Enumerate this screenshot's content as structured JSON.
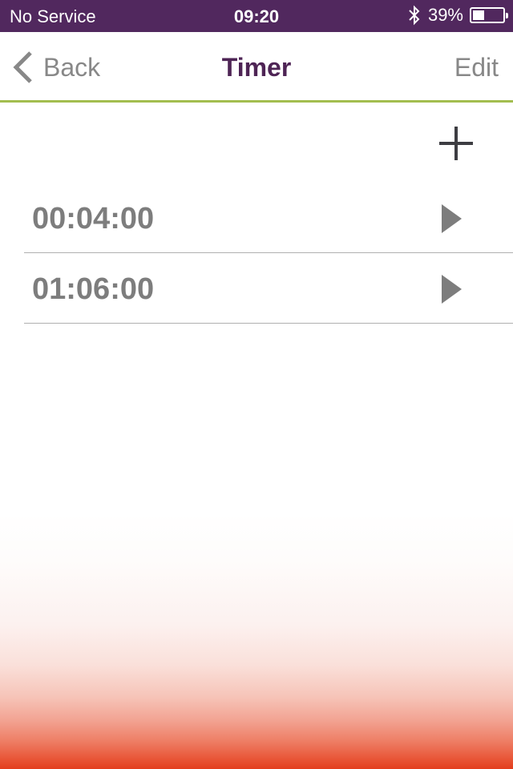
{
  "status_bar": {
    "carrier": "No Service",
    "time": "09:20",
    "bluetooth_icon": "bluetooth-icon",
    "battery_percent_label": "39%",
    "battery_level": 0.39
  },
  "nav": {
    "back_label": "Back",
    "title": "Timer",
    "edit_label": "Edit",
    "accent_color": "#a3bd4f",
    "title_color": "#4e2455"
  },
  "toolbar": {
    "add_icon": "plus-icon"
  },
  "timers": [
    {
      "value": "00:04:00",
      "action_icon": "play-icon"
    },
    {
      "value": "01:06:00",
      "action_icon": "play-icon"
    }
  ],
  "colors": {
    "status_bar_bg": "#51285e",
    "gradient_bottom": "#e33d1c"
  }
}
